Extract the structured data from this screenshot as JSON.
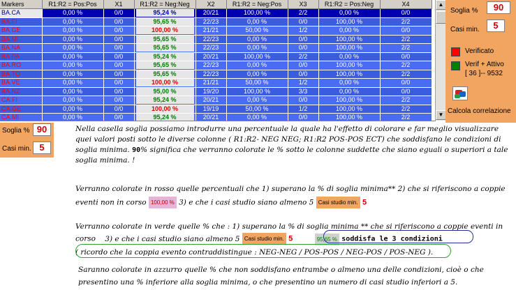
{
  "grid": {
    "headers": [
      "Markers",
      "R1:R2 = Pos:Pos",
      "X1",
      "R1:R2 = Neg:Neg",
      "X2",
      "R1:R2 = Neg:Pos",
      "X3",
      "R1:R2 = Pos:Neg",
      "X4"
    ],
    "rows": [
      {
        "marker": "BA.CA",
        "c1": "0,00 %",
        "x1": "0/0",
        "c2": "95,24 %",
        "x2": "20/21",
        "c3": "100,00 %",
        "x3": "2/2",
        "c4": "0,00 %",
        "x4": "0/0",
        "c2s": "sel",
        "sel": true
      },
      {
        "marker": "BA.FI",
        "c1": "0,00 %",
        "x1": "0/0",
        "c2": "95,65 %",
        "x2": "22/23",
        "c3": "0,00 %",
        "x3": "0/0",
        "c4": "100,00 %",
        "x4": "2/2",
        "c2s": "green"
      },
      {
        "marker": "BA.GE",
        "c1": "0,00 %",
        "x1": "0/0",
        "c2": "100,00 %",
        "x2": "21/21",
        "c3": "50,00 %",
        "x3": "1/2",
        "c4": "0,00 %",
        "x4": "0/0",
        "c2s": "red"
      },
      {
        "marker": "BA.MI",
        "c1": "0,00 %",
        "x1": "0/0",
        "c2": "95,65 %",
        "x2": "22/23",
        "c3": "0,00 %",
        "x3": "0/0",
        "c4": "100,00 %",
        "x4": "2/2",
        "c2s": "green"
      },
      {
        "marker": "BA.NA",
        "c1": "0,00 %",
        "x1": "0/0",
        "c2": "95,65 %",
        "x2": "22/23",
        "c3": "0,00 %",
        "x3": "0/0",
        "c4": "100,00 %",
        "x4": "2/2",
        "c2s": "green"
      },
      {
        "marker": "BA.PA",
        "c1": "0,00 %",
        "x1": "0/0",
        "c2": "95,24 %",
        "x2": "20/21",
        "c3": "100,00 %",
        "x3": "2/2",
        "c4": "0,00 %",
        "x4": "0/0",
        "c2s": "green"
      },
      {
        "marker": "BA.RO",
        "c1": "0,00 %",
        "x1": "0/0",
        "c2": "95,65 %",
        "x2": "22/23",
        "c3": "0,00 %",
        "x3": "0/0",
        "c4": "100,00 %",
        "x4": "2/2",
        "c2s": "green"
      },
      {
        "marker": "BA.TO",
        "c1": "0,00 %",
        "x1": "0/0",
        "c2": "95,65 %",
        "x2": "22/23",
        "c3": "0,00 %",
        "x3": "0/0",
        "c4": "100,00 %",
        "x4": "2/2",
        "c2s": "green"
      },
      {
        "marker": "BA.VE",
        "c1": "0,00 %",
        "x1": "0/0",
        "c2": "100,00 %",
        "x2": "21/21",
        "c3": "50,00 %",
        "x3": "1/2",
        "c4": "0,00 %",
        "x4": "0/0",
        "c2s": "red"
      },
      {
        "marker": "BA.NZ",
        "c1": "0,00 %",
        "x1": "0/0",
        "c2": "95,00 %",
        "x2": "19/20",
        "c3": "100,00 %",
        "x3": "3/3",
        "c4": "0,00 %",
        "x4": "0/0",
        "c2s": "green"
      },
      {
        "marker": "CA.FI",
        "c1": "0,00 %",
        "x1": "0/0",
        "c2": "95,24 %",
        "x2": "20/21",
        "c3": "0,00 %",
        "x3": "0/0",
        "c4": "100,00 %",
        "x4": "2/2",
        "c2s": "green"
      },
      {
        "marker": "CA.GE",
        "c1": "0,00 %",
        "x1": "0/0",
        "c2": "100,00 %",
        "x2": "19/19",
        "c3": "50,00 %",
        "x3": "1/2",
        "c4": "100,00 %",
        "x4": "2/2",
        "c2s": "red"
      },
      {
        "marker": "CA.MI",
        "c1": "0,00 %",
        "x1": "0/0",
        "c2": "95,24 %",
        "x2": "20/21",
        "c3": "0,00 %",
        "x3": "0/0",
        "c4": "100,00 %",
        "x4": "2/2",
        "c2s": "green"
      }
    ]
  },
  "side": {
    "soglia_label": "Soglia %",
    "soglia_value": "90",
    "casi_label": "Casi min.",
    "casi_value": "5",
    "verificato": "Verificato",
    "verif_attivo": "Verif + Attivo",
    "count": "[ 36 ]-- 9532",
    "calc": "Calcola correlazione"
  },
  "panel2": {
    "soglia_label": "Soglia %",
    "soglia_value": "90",
    "casi_label": "Casi min.",
    "casi_value": "5"
  },
  "colors": {
    "red_swatch": "#ff0000",
    "green_swatch": "#008000"
  },
  "doc": {
    "p1_line1": "Nella casella soglia possiamo introdurre una percentuale la quale ha l'effetto di colorare e far meglio visualizzare",
    "p1_line2": "quei valori posti sotto le diverse colonne ( R1:R2- NEG NEG; R1:R2 POS-POS ECT) che soddisfano le condizioni di",
    "p1_line3a": "soglia minima.",
    "p1_line3b": "90",
    "p1_line3c": "% significa che verranno colorate le % sotto le colonne suddette che siano eguali o superiori a tale",
    "p1_line4": "soglia minima. !",
    "p2_line1": "Verranno colorate in rosso quelle percentuali che 1) superano la % di soglia minima** 2) che si riferiscono a coppie",
    "p2_line2a": "eventi non in corso",
    "chip_red": "100,00 %",
    "p2_line2b": "3) e che i casi studio siano almeno 5",
    "chip_casi": "Casi studio min.",
    "p2_five": "5",
    "p3_line1": "Verranno colorate in verde quelle % che : 1) superano la % di soglia minima ** che si riferiscono a coppie eventi in",
    "p3_line2a": "corso",
    "p3_line2b": "3) e che i casi studio siano almeno 5",
    "chip_casi2": "Casi studio min.",
    "p3_five": "5",
    "chip_green": "95,65 %",
    "p3_cond": "soddisfa le 3 condizioni",
    "p3_line3": "( ricordo che la coppia evento contraddistingue : NEG-NEG / POS-POS / NEG-POS / POS-NEG ).",
    "p4_line1": "Saranno colorate in azzurro quelle % che non soddisfano entrambe o almeno una delle condizioni, cioè o che",
    "p4_line2": "presentino una % inferiore alla soglia minima, o che presentino un numero di casi studio inferiori a 5."
  }
}
